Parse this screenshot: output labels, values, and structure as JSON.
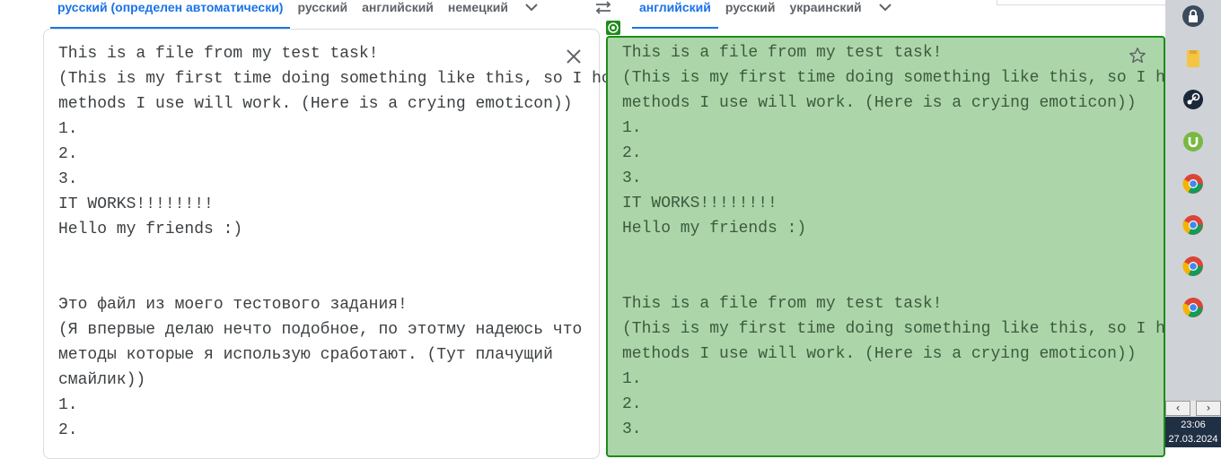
{
  "source": {
    "langs": [
      "русский (определен автоматически)",
      "русский",
      "английский",
      "немецкий"
    ],
    "text": "This is a file from my test task!\n(This is my first time doing something like this, so I hope that the\nmethods I use will work. (Here is a crying emoticon))\n1.\n2.\n3.\nIT WORKS!!!!!!!!\nHello my friends :)\n\n\nЭто файл из моего тестового задания!\n(Я впервые делаю нечто подобное, по этотму надеюсь что\nметоды которые я использую сработают. (Тут плачущий\nсмайлик))\n1.\n2."
  },
  "target": {
    "langs": [
      "английский",
      "русский",
      "украинский"
    ],
    "text": "This is a file from my test task!\n(This is my first time doing something like this, so I hope that the\nmethods I use will work. (Here is a crying emoticon))\n1.\n2.\n3.\nIT WORKS!!!!!!!!\nHello my friends :)\n\n\nThis is a file from my test task!\n(This is my first time doing something like this, so I hope that the\nmethods I use will work. (Here is a crying emoticon))\n1.\n2.\n3."
  },
  "icons": {
    "clear": "close-icon",
    "star": "star-icon",
    "swap": "swap-languages-icon",
    "tray": [
      "lock-icon",
      "folder-icon",
      "steam-icon",
      "utorrent-icon",
      "chrome-icon",
      "chrome-icon",
      "chrome-icon",
      "chrome-icon"
    ]
  },
  "taskbar": {
    "time": "23:06",
    "date": "27.03.2024"
  },
  "colors": {
    "accent": "#1a73e8",
    "highlight_bg": "#acd6aa",
    "highlight_border": "#1e8c1a"
  }
}
